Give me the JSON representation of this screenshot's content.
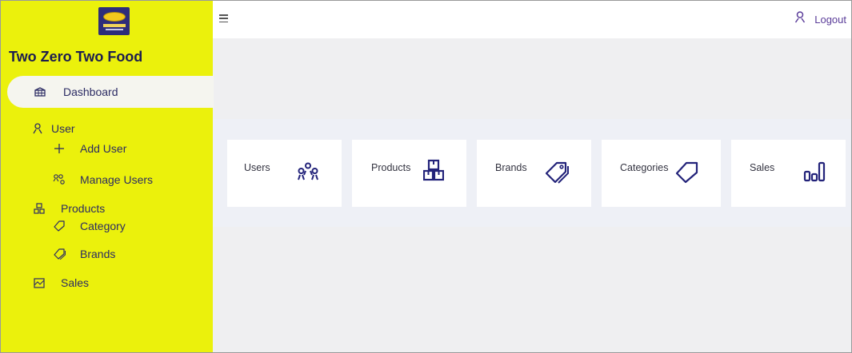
{
  "brand": {
    "title": "Two Zero Two Food",
    "logo_name": "two-zero-two-food-logo"
  },
  "sidebar": {
    "items": [
      {
        "label": "Dashboard",
        "icon": "dashboard-icon",
        "active": true
      },
      {
        "label": "User",
        "icon": "user-icon"
      },
      {
        "label": "Add User",
        "icon": "plus-icon"
      },
      {
        "label": "Manage Users",
        "icon": "users-icon"
      },
      {
        "label": "Products",
        "icon": "boxes-icon"
      },
      {
        "label": "Category",
        "icon": "tag-icon"
      },
      {
        "label": "Brands",
        "icon": "tags-icon"
      },
      {
        "label": "Sales",
        "icon": "sales-chart-icon"
      }
    ]
  },
  "topbar": {
    "menu_icon": "hamburger-menu-icon",
    "user_icon": "user-icon",
    "logout_label": "Logout"
  },
  "cards": [
    {
      "label": "Users",
      "icon": "users-icon"
    },
    {
      "label": "Products",
      "icon": "boxes-icon"
    },
    {
      "label": "Brands",
      "icon": "tags-icon"
    },
    {
      "label": "Categories",
      "icon": "tag-icon"
    },
    {
      "label": "Sales",
      "icon": "bar-chart-icon"
    }
  ],
  "colors": {
    "sidebar_bg": "#ebf10c",
    "primary_text": "#1d1d4f",
    "accent_purple": "#5a3c99",
    "icon_navy": "#23237a"
  }
}
